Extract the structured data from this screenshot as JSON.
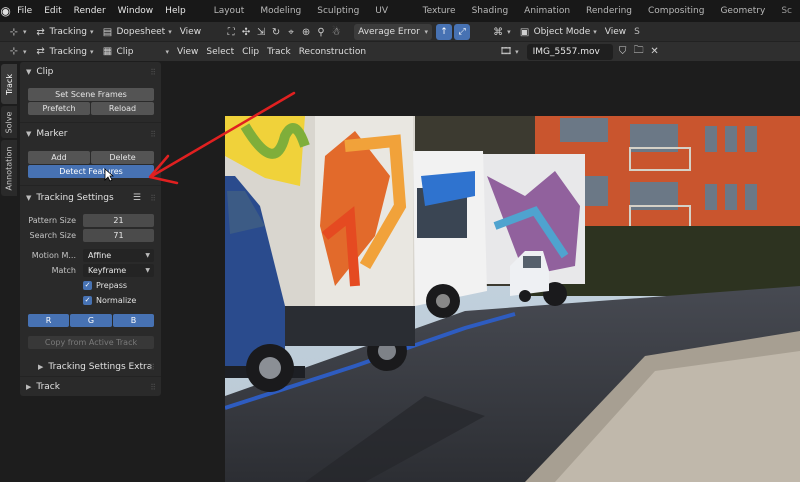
{
  "menubar": {
    "items": [
      "File",
      "Edit",
      "Render",
      "Window",
      "Help"
    ],
    "workspaces": [
      "Layout",
      "Modeling",
      "Sculpting",
      "UV Editing",
      "Texture Paint",
      "Shading",
      "Animation",
      "Rendering",
      "Compositing",
      "Geometry Nodes",
      "Sc"
    ]
  },
  "header1": {
    "mode": "Tracking",
    "view_type": "Dopesheet",
    "view_menu": "View",
    "average_error_label": "Average Error",
    "object_mode": "Object Mode",
    "view_menu2": "View"
  },
  "header2": {
    "mode": "Tracking",
    "clip_type": "Clip",
    "menus": [
      "View",
      "Select",
      "Clip",
      "Track",
      "Reconstruction"
    ],
    "file_name": "IMG_5557.mov"
  },
  "vtabs": [
    "Track",
    "Solve",
    "Annotation"
  ],
  "panel": {
    "clip": {
      "title": "Clip",
      "set_scene_frames": "Set Scene Frames",
      "prefetch": "Prefetch",
      "reload": "Reload"
    },
    "marker": {
      "title": "Marker",
      "add": "Add",
      "delete": "Delete",
      "detect_features": "Detect Features"
    },
    "tracking_settings": {
      "title": "Tracking Settings",
      "pattern_size_label": "Pattern Size",
      "pattern_size": "21",
      "search_size_label": "Search Size",
      "search_size": "71",
      "motion_model_label": "Motion M...",
      "motion_model": "Affine",
      "match_label": "Match",
      "match": "Keyframe",
      "prepass": "Prepass",
      "normalize": "Normalize",
      "channels": [
        "R",
        "G",
        "B"
      ],
      "copy_from_active": "Copy from Active Track",
      "extra": "Tracking Settings Extra"
    },
    "track": {
      "title": "Track"
    }
  },
  "colors": {
    "accent": "#4772b3",
    "annotation_arrow": "#e02020",
    "panel_bg": "#2a2a2a"
  }
}
